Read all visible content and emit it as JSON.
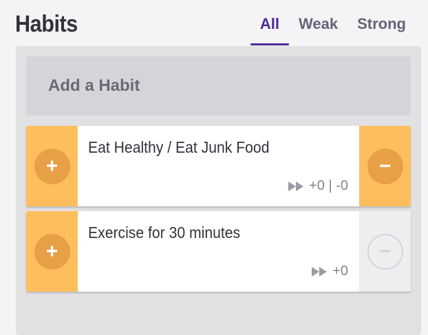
{
  "header": {
    "title": "Habits",
    "tabs": [
      {
        "label": "All",
        "active": true
      },
      {
        "label": "Weak",
        "active": false
      },
      {
        "label": "Strong",
        "active": false
      }
    ]
  },
  "add_habit": {
    "placeholder": "Add a Habit"
  },
  "habits": [
    {
      "text": "Eat Healthy / Eat Junk Food",
      "score": "+0 | -0",
      "positive_icon": "+",
      "negative_icon": "−",
      "negative_enabled": true
    },
    {
      "text": "Exercise for 30 minutes",
      "score": "+0",
      "positive_icon": "+",
      "negative_icon": "−",
      "negative_enabled": false
    }
  ],
  "colors": {
    "accent": "#4f2a93",
    "habit_side": "#ffbe5d",
    "habit_button": "#e8a047"
  }
}
